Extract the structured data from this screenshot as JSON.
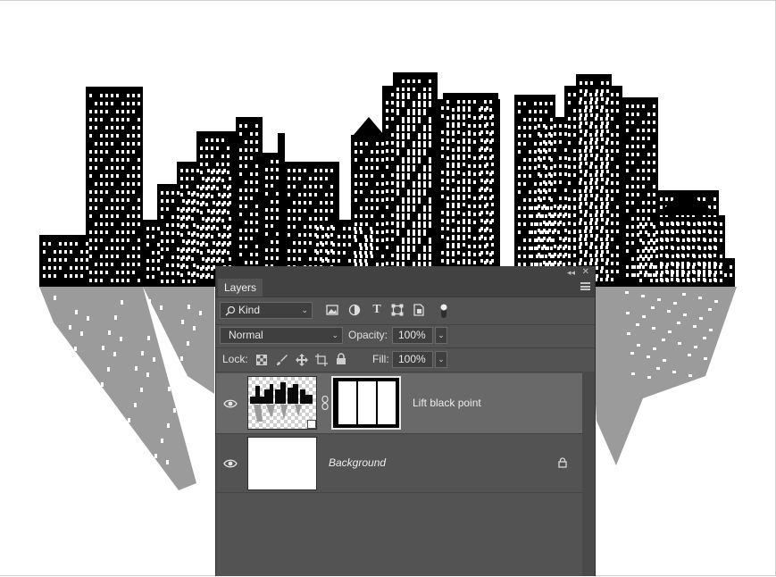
{
  "panel": {
    "tab_label": "Layers",
    "filter": {
      "kind_label": "Kind",
      "kind_icon": "search-icon"
    },
    "filter_icons": [
      "image-filter-icon",
      "adjustment-filter-icon",
      "type-filter-icon",
      "shape-filter-icon",
      "smart-object-filter-icon",
      "filter-toggle-icon"
    ],
    "blend_mode": "Normal",
    "opacity_label": "Opacity:",
    "opacity_value": "100%",
    "lock_label": "Lock:",
    "lock_icons": [
      "lock-transparent-icon",
      "lock-image-icon",
      "lock-position-icon",
      "lock-artboard-icon",
      "lock-all-icon"
    ],
    "fill_label": "Fill:",
    "fill_value": "100%"
  },
  "layers": [
    {
      "name": "Lift black point",
      "visible": true,
      "selected": true,
      "italic": false,
      "has_mask": true,
      "locked": false
    },
    {
      "name": "Background",
      "visible": true,
      "selected": false,
      "italic": true,
      "has_mask": false,
      "locked": true
    }
  ],
  "colors": {
    "panel_bg": "#535353",
    "selected_row": "#696969",
    "header_bg": "#424242"
  }
}
